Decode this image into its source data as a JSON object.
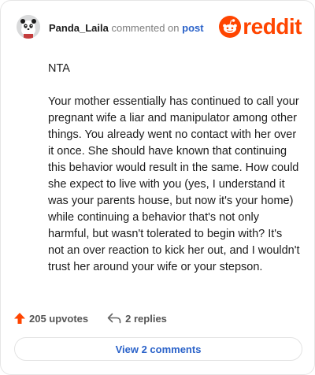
{
  "header": {
    "username": "Panda_Laila",
    "commented_text": "commented on",
    "post_link": "post",
    "brand": {
      "wordmark": "reddit",
      "icon": "reddit-snoo-icon",
      "color": "#ff4500"
    },
    "avatar_icon": "avatar-icon"
  },
  "comment": {
    "verdict": "NTA",
    "paragraph": "Your mother essentially has continued to call your pregnant wife a liar and manipulator among other things. You already went no contact with her over it once. She should have known that continuing this behavior would result in the same. How could she expect to live with you (yes, I understand it was your parents house, but now it's your home) while continuing a behavior that's not only harmful, but wasn't tolerated to begin with? It's not an over reaction to kick her out, and I wouldn't trust her around your wife or your stepson."
  },
  "actions": {
    "upvotes": "205 upvotes",
    "upvote_icon": "upvote-arrow-icon",
    "upvote_color": "#ff4500",
    "replies": "2 replies",
    "reply_icon": "reply-arrow-icon"
  },
  "footer": {
    "view_comments_label": "View 2 comments",
    "link_color": "#2a62c9"
  }
}
